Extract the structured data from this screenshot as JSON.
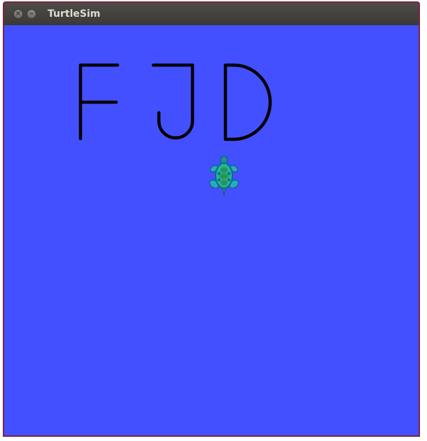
{
  "window": {
    "title": "TurtleSim",
    "close_glyph": "×",
    "minimize_glyph": "–"
  },
  "canvas": {
    "background_color": "#4350ff",
    "pen_color": "#000000",
    "drawn_letters": [
      "F",
      "J",
      "D"
    ]
  },
  "turtle": {
    "icon": "turtle-icon",
    "colors": {
      "shell": "#1fb3a8",
      "shell_dark": "#0e6e78",
      "spots": "#2f8f3a",
      "flippers": "#2aa8c8"
    }
  },
  "colors": {
    "window_border": "#7a2440",
    "titlebar": "#3f3e3a",
    "title_text": "#dfdbd2"
  }
}
